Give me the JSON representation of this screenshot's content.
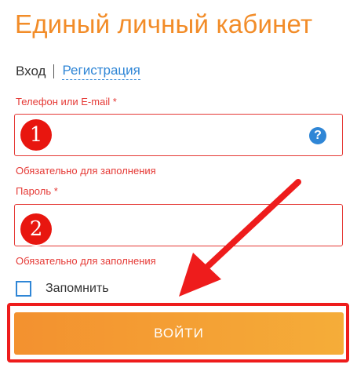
{
  "header": {
    "title": "Единый личный кабинет"
  },
  "tabs": {
    "login": "Вход",
    "register": "Регистрация"
  },
  "form": {
    "phone": {
      "label": "Телефон или E-mail *",
      "value": "",
      "error": "Обязательно для заполнения",
      "help_icon": "?"
    },
    "password": {
      "label": "Пароль *",
      "value": "",
      "error": "Обязательно для заполнения"
    },
    "remember": {
      "label": "Запомнить",
      "checked": false
    },
    "submit_label": "ВОЙТИ"
  },
  "annotations": {
    "marker_1": "1",
    "marker_2": "2"
  },
  "colors": {
    "accent_orange": "#f28c28",
    "link_blue": "#2f86d6",
    "error_red": "#e53935",
    "annotation_red": "#e8160f"
  }
}
